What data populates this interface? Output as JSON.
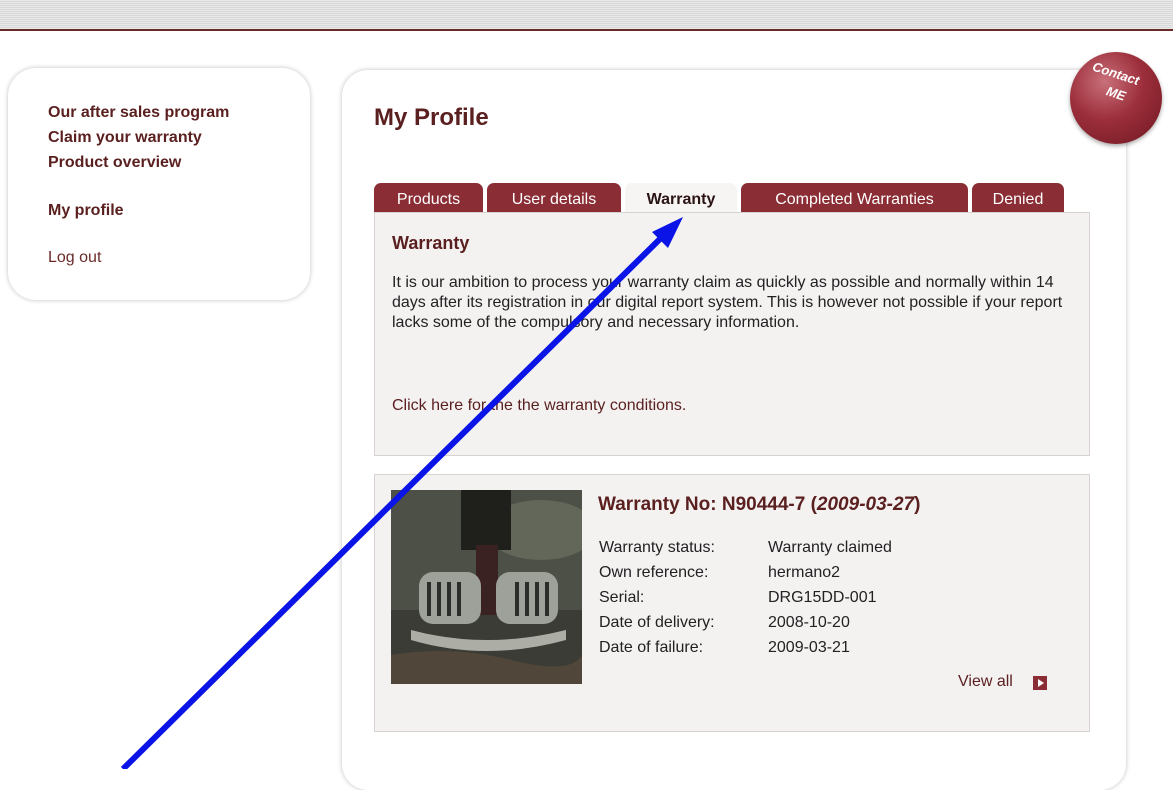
{
  "nav": {
    "items": [
      {
        "label": "Our after sales program"
      },
      {
        "label": "Claim your warranty"
      },
      {
        "label": "Product overview"
      },
      {
        "label": "My profile"
      },
      {
        "label": "Log out"
      }
    ]
  },
  "page": {
    "title": "My Profile",
    "contact_line1": "Contact",
    "contact_line2": "ME"
  },
  "tabs": [
    {
      "label": "Products"
    },
    {
      "label": "User details"
    },
    {
      "label": "Warranty",
      "active": true
    },
    {
      "label": "Completed Warranties"
    },
    {
      "label": "Denied"
    }
  ],
  "warranty_info": {
    "heading": "Warranty",
    "body": "It is our ambition to process your warranty claim as quickly as possible and normally within 14 days after its registration in our digital report system. This is however not possible if your report lacks some of the compulsory and necessary information.",
    "link": "Click here for the the warranty conditions."
  },
  "record": {
    "title_prefix": "Warranty No: N90444-7 (",
    "title_date": "2009-03-27",
    "title_suffix": ")",
    "fields": [
      {
        "label": "Warranty status:",
        "value": "Warranty claimed"
      },
      {
        "label": "Own reference:",
        "value": "hermano2"
      },
      {
        "label": "Serial:",
        "value": "DRG15DD-001"
      },
      {
        "label": "Date of delivery:",
        "value": "2008-10-20"
      },
      {
        "label": "Date of failure:",
        "value": "2009-03-21"
      }
    ],
    "view_all": "View all"
  },
  "colors": {
    "brand": "#8a2d34",
    "heading": "#5a1f1f",
    "annotation_arrow": "#0000ee"
  }
}
